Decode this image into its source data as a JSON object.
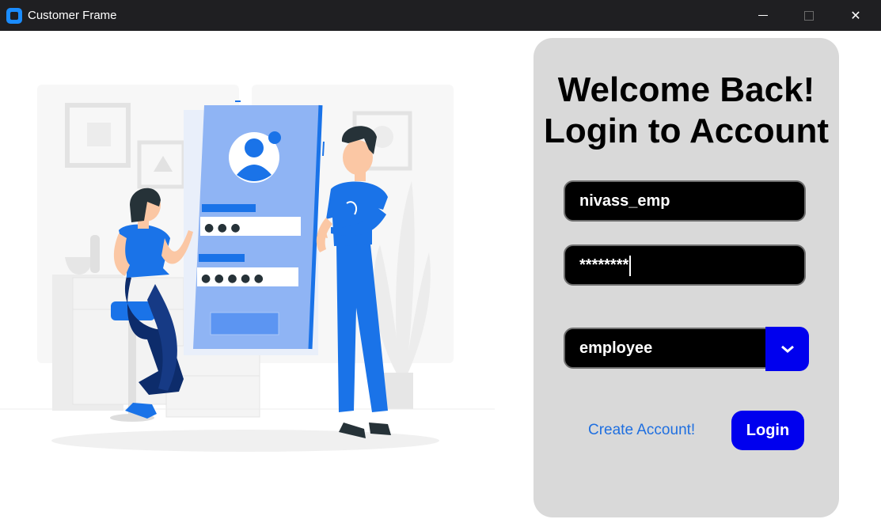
{
  "window": {
    "title": "Customer Frame",
    "controls": {
      "minimize": "minimize",
      "maximize": "maximize",
      "close": "✕"
    }
  },
  "illustration": {
    "password_dots_1": "● ● ●",
    "password_dots_2": "● ● ● ● ●"
  },
  "login_card": {
    "heading_line1": "Welcome Back!",
    "heading_line2": "Login to Account",
    "username_value": "nivass_emp",
    "password_value": "********",
    "role_value": "employee",
    "create_account_label": "Create Account!",
    "login_label": "Login"
  },
  "colors": {
    "accent": "#0000ee",
    "link": "#1f6fe0",
    "card_bg": "#d9d9d9",
    "titlebar_bg": "#1f1f22",
    "illustration_blue": "#1a73e8"
  },
  "icons": [
    "app-icon",
    "minimize-icon",
    "maximize-icon",
    "close-icon",
    "chevron-down-icon"
  ]
}
